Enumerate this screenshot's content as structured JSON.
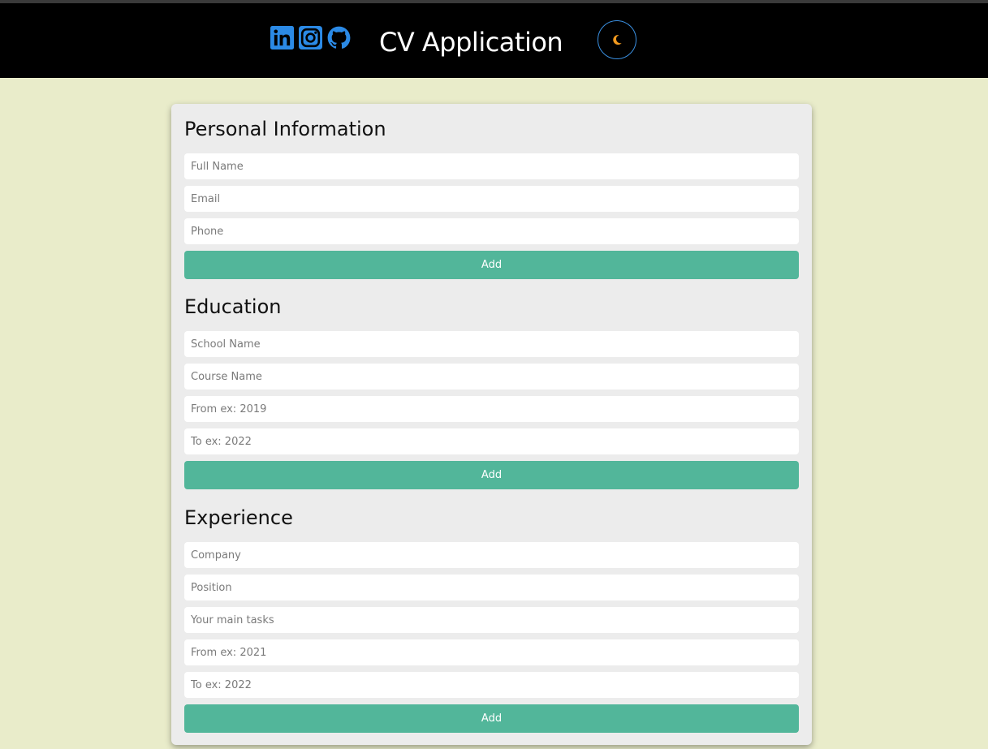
{
  "header": {
    "title": "CV Application",
    "socials": [
      {
        "name": "linkedin",
        "icon": "linkedin-icon"
      },
      {
        "name": "instagram",
        "icon": "instagram-icon"
      },
      {
        "name": "github",
        "icon": "github-icon"
      }
    ],
    "theme_toggle_icon": "moon-icon"
  },
  "colors": {
    "header_bg": "#000000",
    "page_bg": "#e9ecca",
    "card_bg": "#ececec",
    "accent": "#52b69a",
    "social_blue": "#2b8ae6",
    "moon": "#f29a1f"
  },
  "personal": {
    "title": "Personal Information",
    "full_name_placeholder": "Full Name",
    "email_placeholder": "Email",
    "phone_placeholder": "Phone",
    "add_label": "Add"
  },
  "education": {
    "title": "Education",
    "school_placeholder": "School Name",
    "course_placeholder": "Course Name",
    "from_placeholder": "From ex: 2019",
    "to_placeholder": "To ex: 2022",
    "add_label": "Add"
  },
  "experience": {
    "title": "Experience",
    "company_placeholder": "Company",
    "position_placeholder": "Position",
    "tasks_placeholder": "Your main tasks",
    "from_placeholder": "From ex: 2021",
    "to_placeholder": "To ex: 2022",
    "add_label": "Add"
  }
}
